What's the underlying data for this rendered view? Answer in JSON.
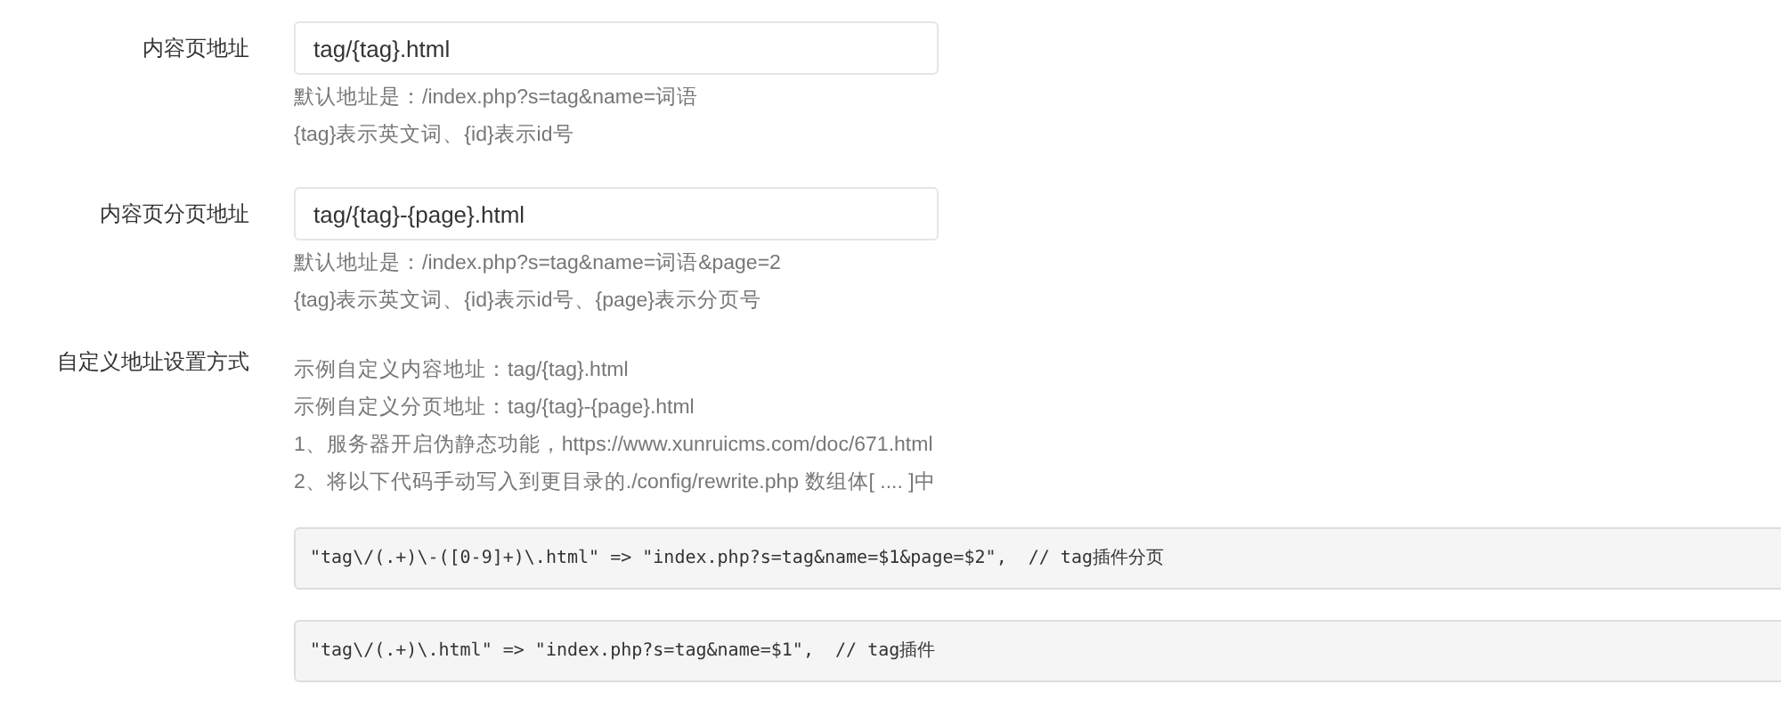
{
  "rows": [
    {
      "label": "内容页地址",
      "value": "tag/{tag}.html",
      "help": [
        "默认地址是：/index.php?s=tag&name=词语",
        "{tag}表示英文词、{id}表示id号"
      ]
    },
    {
      "label": "内容页分页地址",
      "value": "tag/{tag}-{page}.html",
      "help": [
        "默认地址是：/index.php?s=tag&name=词语&page=2",
        "{tag}表示英文词、{id}表示id号、{page}表示分页号"
      ]
    }
  ],
  "custom": {
    "label": "自定义地址设置方式",
    "lines": [
      "示例自定义内容地址：tag/{tag}.html",
      "示例自定义分页地址：tag/{tag}-{page}.html",
      "1、服务器开启伪静态功能，https://www.xunruicms.com/doc/671.html",
      "2、将以下代码手动写入到更目录的./config/rewrite.php 数组体[ .... ]中"
    ],
    "code": [
      "\"tag\\/(.+)\\-([0-9]+)\\.html\" => \"index.php?s=tag&name=$1&page=$2\",  // tag插件分页",
      "\"tag\\/(.+)\\.html\" => \"index.php?s=tag&name=$1\",  // tag插件"
    ]
  }
}
